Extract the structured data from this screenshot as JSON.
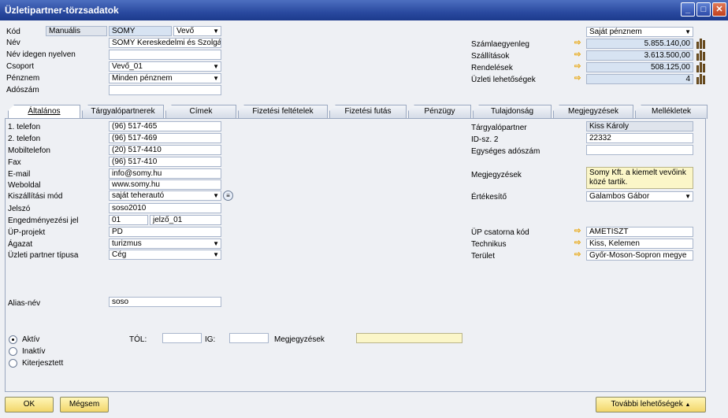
{
  "window": {
    "title": "Üzletipartner-törzsadatok"
  },
  "header": {
    "kod_label": "Kód",
    "kod_mode": "Manuális",
    "kod_value": "SOMY",
    "kod_type": "Vevő",
    "nev_label": "Név",
    "nev_value": "SOMY Kereskedelmi és Szolgálta",
    "nev_idegen_label": "Név idegen nyelven",
    "nev_idegen_value": "",
    "csoport_label": "Csoport",
    "csoport_value": "Vevő_01",
    "penznem_label": "Pénznem",
    "penznem_value": "Minden pénznem",
    "adoszam_label": "Adószám",
    "adoszam_value": "",
    "currency_select": "Saját pénznem",
    "szamlaegyenleg_label": "Számlaegyenleg",
    "szamlaegyenleg_value": "5.855.140,00",
    "szallitasok_label": "Szállítások",
    "szallitasok_value": "3.613.500,00",
    "rendelesek_label": "Rendelések",
    "rendelesek_value": "508.125,00",
    "uzleti_lehetosegek_label": "Üzleti lehetőségek",
    "uzleti_lehetosegek_value": "4"
  },
  "tabs": [
    "Általános",
    "Tárgyalópartnerek",
    "Címek",
    "Fizetési feltételek",
    "Fizetési futás",
    "Pénzügy",
    "Tulajdonság",
    "Megjegyzések",
    "Mellékletek"
  ],
  "general": {
    "telefon1_label": "1. telefon",
    "telefon1": "(96) 517-465",
    "telefon2_label": "2. telefon",
    "telefon2": "(96) 517-469",
    "mobil_label": "Mobiltelefon",
    "mobil": "(20) 517-4410",
    "fax_label": "Fax",
    "fax": "(96) 517-410",
    "email_label": "E-mail",
    "email": "info@somy.hu",
    "web_label": "Weboldal",
    "web": "www.somy.hu",
    "szallitasi_label": "Kiszállítási mód",
    "szallitasi": "saját teherautó",
    "jelszo_label": "Jelszó",
    "jelszo": "soso2010",
    "engedmeny_label": "Engedményezési jel",
    "engedmeny1": "01",
    "engedmeny2": "jelző_01",
    "up_projekt_label": "ÜP-projekt",
    "up_projekt": "PD",
    "agazat_label": "Ágazat",
    "agazat": "turizmus",
    "partner_tipus_label": "Üzleti partner típusa",
    "partner_tipus": "Cég",
    "alias_label": "Alias-név",
    "alias": "soso",
    "targyalo_label": "Tárgyalópartner",
    "targyalo": "Kiss Károly",
    "idsz2_label": "ID-sz. 2",
    "idsz2": "22332",
    "egyseges_label": "Egységes adószám",
    "egyseges": "",
    "megjegyzesek_label": "Megjegyzések",
    "megjegyzesek": "Somy Kft. a kiemelt vevőink közé tartik.",
    "ertekesito_label": "Értékesítő",
    "ertekesito": "Galambos Gábor",
    "up_csatorna_label": "ÜP csatorna kód",
    "up_csatorna": "AMETISZT",
    "technikus_label": "Technikus",
    "technikus": "Kiss, Kelemen",
    "terulet_label": "Terület",
    "terulet": "Győr-Moson-Sopron megye"
  },
  "status": {
    "aktiv": "Aktív",
    "inaktiv": "Inaktív",
    "kiterjesztett": "Kiterjesztett",
    "tol_label": "TÓL:",
    "ig_label": "IG:",
    "megj_label": "Megjegyzések"
  },
  "buttons": {
    "ok": "OK",
    "cancel": "Mégsem",
    "more": "További lehetőségek"
  },
  "colors": {
    "titlebar": "#2a4aa0",
    "button": "#f2d66a",
    "arrow": "#e8a200"
  }
}
